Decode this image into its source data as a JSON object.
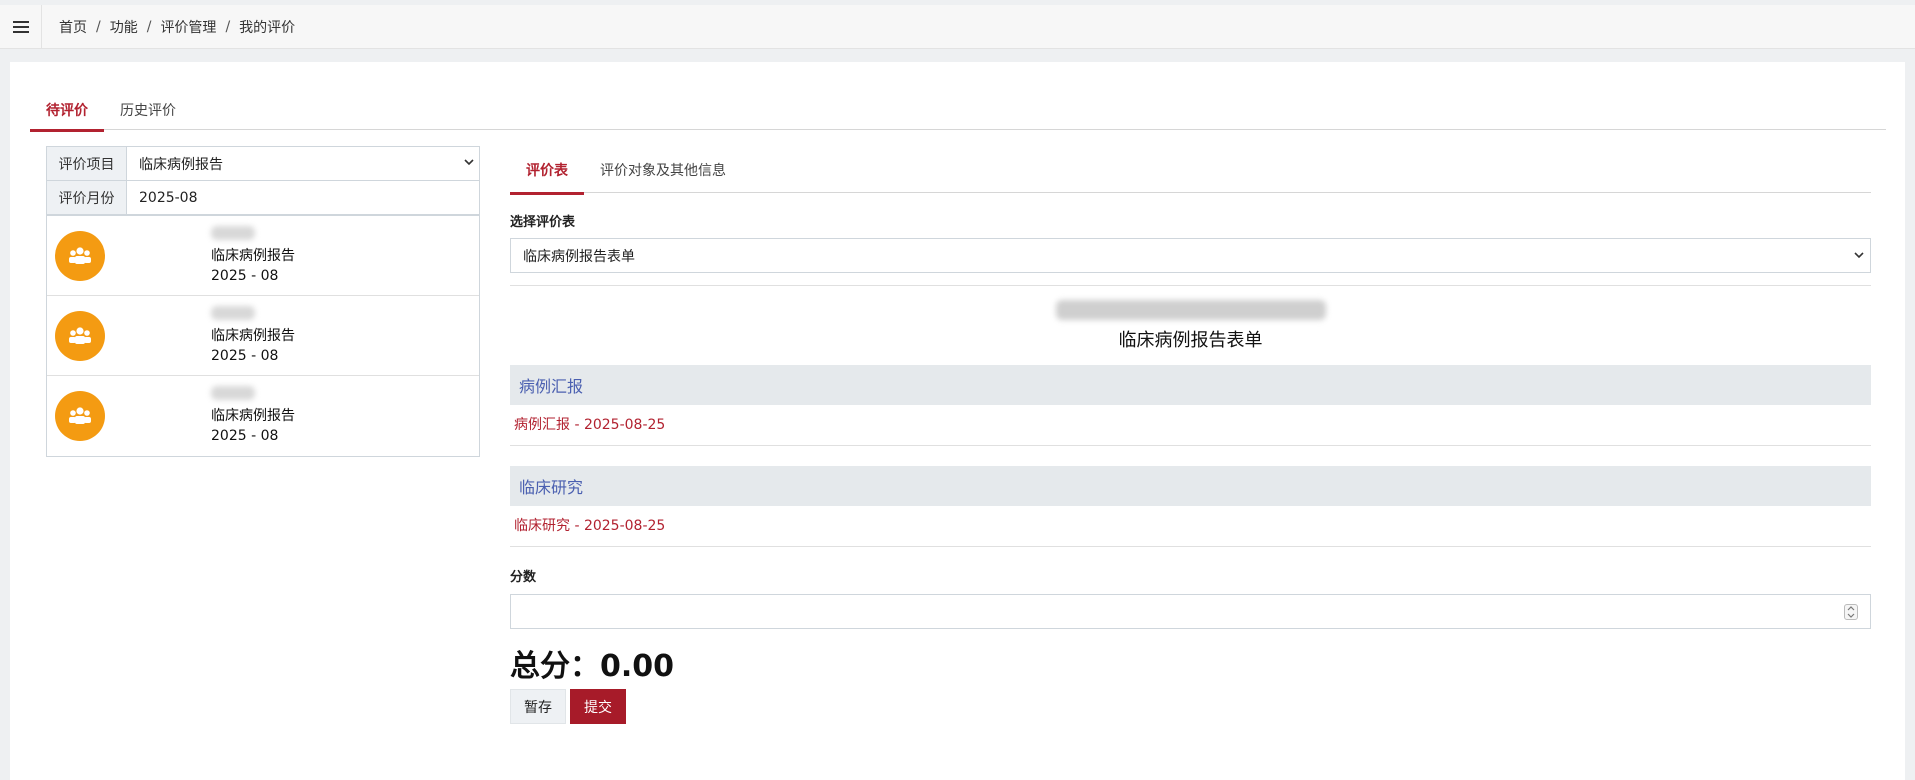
{
  "breadcrumb": {
    "items": [
      "首页",
      "功能",
      "评价管理",
      "我的评价"
    ],
    "separator": "/"
  },
  "main_tabs": [
    {
      "label": "待评价",
      "active": true
    },
    {
      "label": "历史评价",
      "active": false
    }
  ],
  "filters": {
    "project_label": "评价项目",
    "project_value": "临床病例报告",
    "month_label": "评价月份",
    "month_value": "2025-08"
  },
  "pending_list": [
    {
      "type": "临床病例报告",
      "month": "2025 - 08"
    },
    {
      "type": "临床病例报告",
      "month": "2025 - 08"
    },
    {
      "type": "临床病例报告",
      "month": "2025 - 08"
    }
  ],
  "sub_tabs": [
    {
      "label": "评价表",
      "active": true
    },
    {
      "label": "评价对象及其他信息",
      "active": false
    }
  ],
  "form_select": {
    "label": "选择评价表",
    "value": "临床病例报告表单"
  },
  "form": {
    "title": "临床病例报告表单",
    "sections": [
      {
        "title": "病例汇报",
        "link": "病例汇报 - 2025-08-25"
      },
      {
        "title": "临床研究",
        "link": "临床研究 - 2025-08-25"
      }
    ],
    "score_label": "分数",
    "total_text": "总分：0.00"
  },
  "buttons": {
    "save": "暂存",
    "submit": "提交"
  },
  "colors": {
    "accent": "#b22230",
    "avatar": "#f49b12",
    "section_title": "#4a5fb0",
    "section_bg": "#e5e9ec"
  }
}
